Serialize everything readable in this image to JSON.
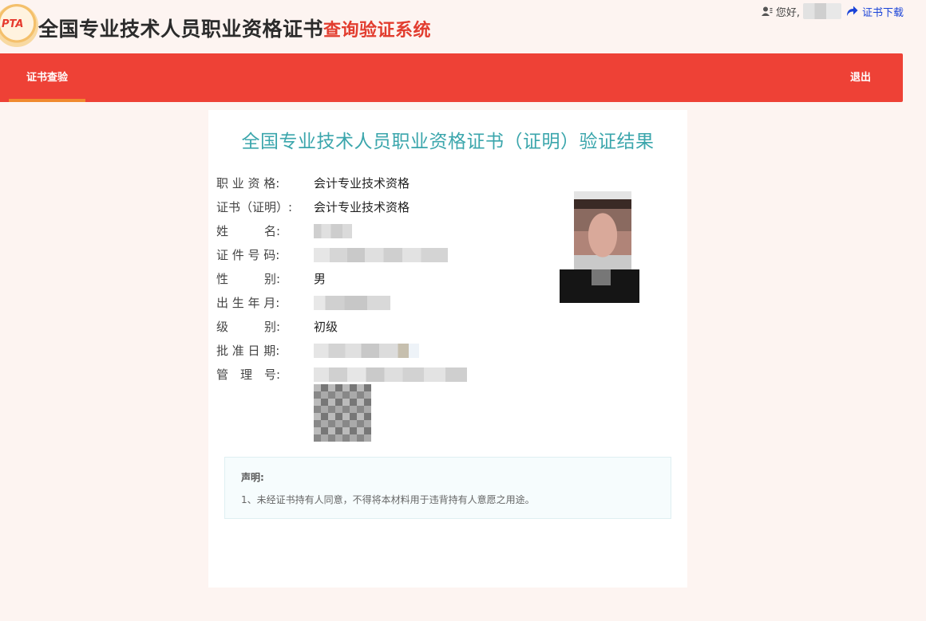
{
  "header": {
    "logo_text": "PTA",
    "title_main": "全国专业技术人员职业资格证书",
    "title_sub": "查询验证系统",
    "greeting": "您好,",
    "download_label": "证书下载"
  },
  "nav": {
    "tab_label": "证书查验",
    "logout_label": "退出",
    "accent_color": "#ee4136",
    "active_bar_color": "#f08a2f"
  },
  "result": {
    "title": "全国专业技术人员职业资格证书（证明）验证结果",
    "fields": [
      {
        "label": "职 业 资 格:",
        "value": "会计专业技术资格"
      },
      {
        "label": "证书（证明）:",
        "value": "会计专业技术资格"
      },
      {
        "label": "姓　　　名:",
        "value": ""
      },
      {
        "label": "证 件 号 码:",
        "value": ""
      },
      {
        "label": "性　　　别:",
        "value": "男"
      },
      {
        "label": "出 生 年 月:",
        "value": ""
      },
      {
        "label": "级　　　别:",
        "value": "初级"
      },
      {
        "label": "批 准 日 期:",
        "value": ""
      },
      {
        "label": "管　理　号:",
        "value": ""
      }
    ]
  },
  "notice": {
    "title": "声明:",
    "text": "1、未经证书持有人同意，不得将本材料用于违背持有人意愿之用途。"
  },
  "icons": [
    "user-icon",
    "share-arrow-icon",
    "logo-icon"
  ]
}
